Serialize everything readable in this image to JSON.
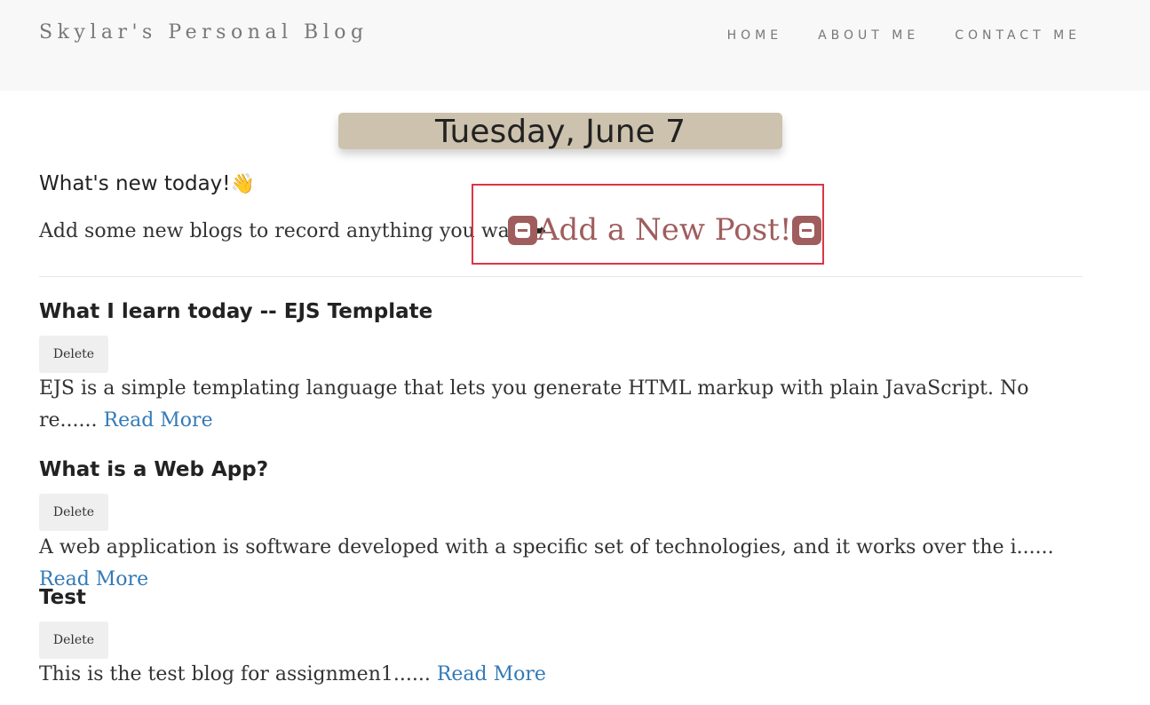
{
  "header": {
    "brand": "Skylar's Personal Blog",
    "nav": [
      "HOME",
      "ABOUT ME",
      "CONTACT ME"
    ]
  },
  "date": "Tuesday, June 7",
  "intro": {
    "heading": "What's new today!",
    "wave": "👋",
    "text": "Add some new blogs to record anything you want",
    "arrow": "➡",
    "add_post_label": "Add a New Post!"
  },
  "posts": [
    {
      "title": "What I learn today -- EJS Template",
      "delete_label": "Delete",
      "excerpt": "EJS is a simple templating language that lets you generate HTML markup with plain JavaScript. No re......",
      "read_more": "Read More"
    },
    {
      "title": "What is a Web App?",
      "delete_label": "Delete",
      "excerpt": "A web application is software developed with a specific set of technologies, and it works over the i......",
      "read_more": "Read More"
    },
    {
      "title": "Test",
      "delete_label": "Delete",
      "excerpt": "This is the test blog for assignmen1......",
      "read_more": "Read More"
    }
  ],
  "colors": {
    "navbar_bg": "#f8f8f8",
    "date_banner_bg": "#cdc2ae",
    "add_post_color": "#a05d5d",
    "highlight_border": "#dc3545",
    "link": "#337ab7"
  },
  "icons": [
    "waving-hand-icon",
    "right-arrow-icon",
    "blogger-icon"
  ]
}
